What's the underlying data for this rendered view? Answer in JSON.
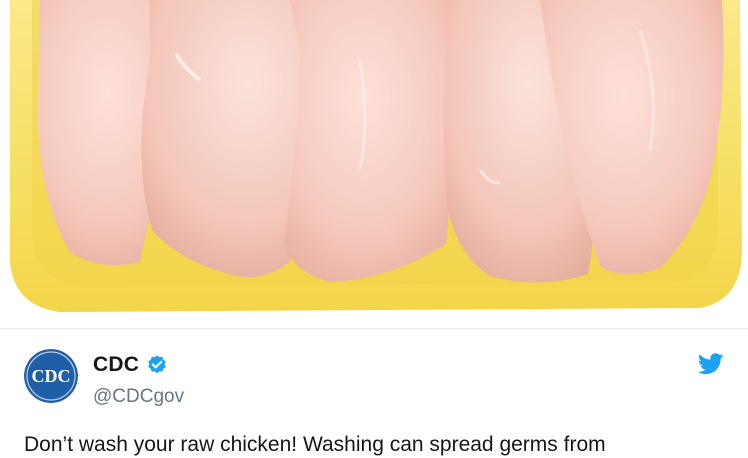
{
  "media": {
    "icon": "raw-chicken-photo"
  },
  "author": {
    "display_name": "CDC",
    "handle": "@CDCgov",
    "avatar_text": "CDC",
    "verified": true
  },
  "tweet": {
    "text": "Don’t wash your raw chicken! Washing can spread germs from"
  },
  "colors": {
    "accent": "#1da1f2",
    "avatar_blue": "#1f5fa7",
    "tray_yellow": "#f6dd5c"
  },
  "icons": [
    "verified-badge-icon",
    "twitter-bird-icon"
  ]
}
